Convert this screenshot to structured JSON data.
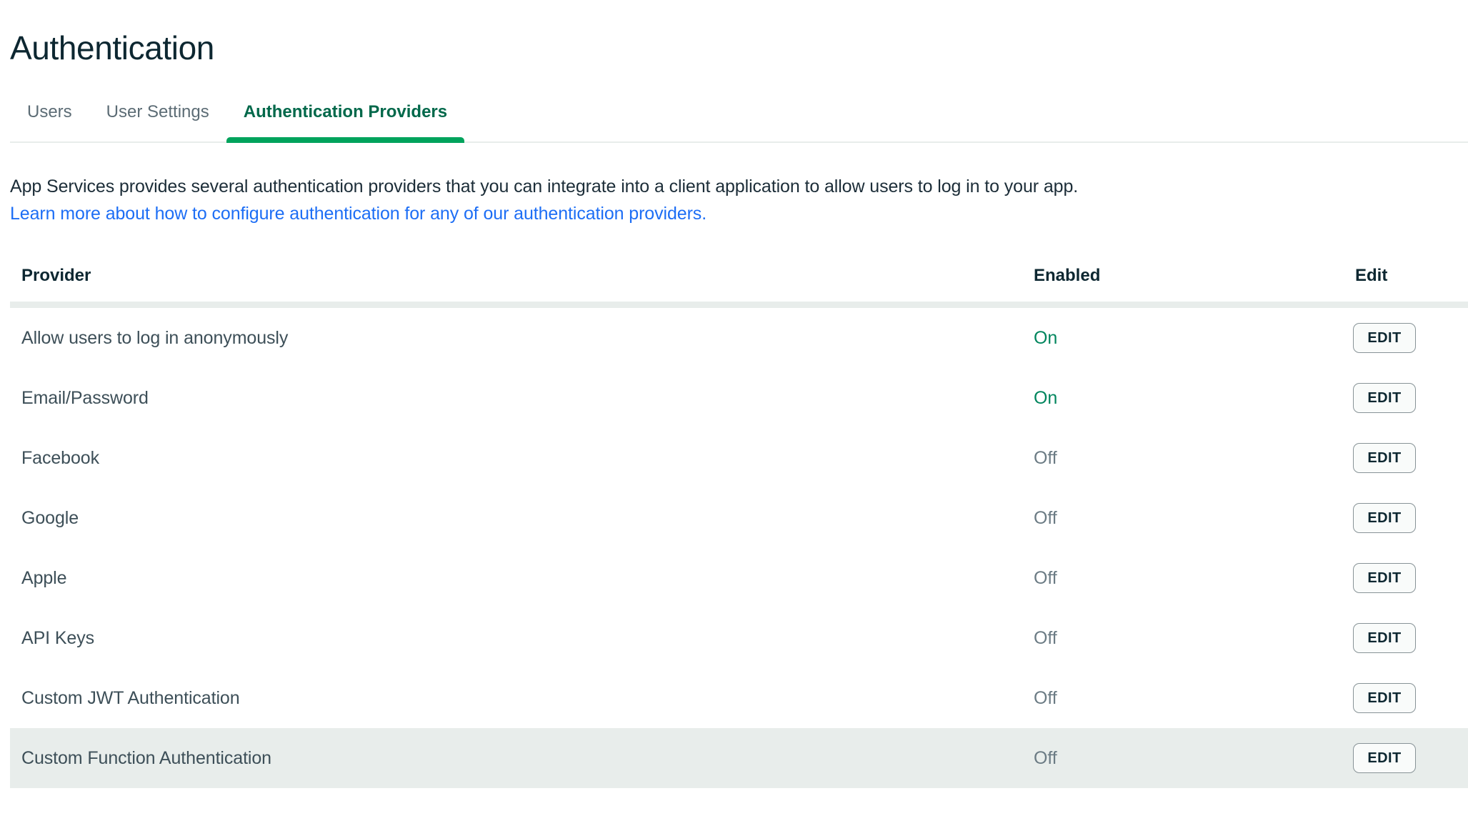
{
  "page": {
    "title": "Authentication"
  },
  "tabs": [
    {
      "label": "Users",
      "active": false
    },
    {
      "label": "User Settings",
      "active": false
    },
    {
      "label": "Authentication Providers",
      "active": true
    }
  ],
  "description": {
    "paragraph": "App Services provides several authentication providers that you can integrate into a client application to allow users to log in to your app.",
    "link_text": "Learn more about how to configure authentication for any of our authentication providers."
  },
  "table": {
    "columns": [
      "Provider",
      "Enabled",
      "Edit"
    ],
    "edit_label": "EDIT",
    "rows": [
      {
        "provider": "Allow users to log in anonymously",
        "enabled": "On",
        "state": "on",
        "highlighted": false
      },
      {
        "provider": "Email/Password",
        "enabled": "On",
        "state": "on",
        "highlighted": false
      },
      {
        "provider": "Facebook",
        "enabled": "Off",
        "state": "off",
        "highlighted": false
      },
      {
        "provider": "Google",
        "enabled": "Off",
        "state": "off",
        "highlighted": false
      },
      {
        "provider": "Apple",
        "enabled": "Off",
        "state": "off",
        "highlighted": false
      },
      {
        "provider": "API Keys",
        "enabled": "Off",
        "state": "off",
        "highlighted": false
      },
      {
        "provider": "Custom JWT Authentication",
        "enabled": "Off",
        "state": "off",
        "highlighted": false
      },
      {
        "provider": "Custom Function Authentication",
        "enabled": "Off",
        "state": "off",
        "highlighted": true
      }
    ]
  },
  "colors": {
    "brand_green": "#00a35c",
    "active_tab_text": "#00684a",
    "enabled_on": "#00855d",
    "enabled_off": "#6b7b84",
    "link_blue": "#1d6ef5",
    "row_highlight": "#e8edeb",
    "title_text": "#0d2731"
  }
}
